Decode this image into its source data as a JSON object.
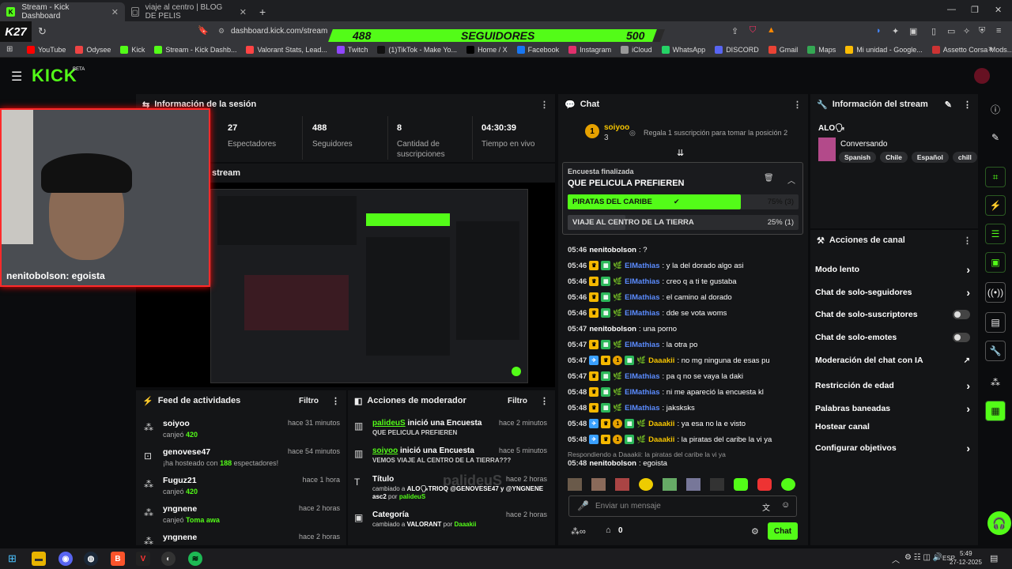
{
  "browser": {
    "tabs": [
      {
        "label": "Stream - Kick Dashboard",
        "active": true
      },
      {
        "label": "viaje al centro | BLOG DE PELIS",
        "active": false
      }
    ],
    "new_tab": "+",
    "url": "dashboard.kick.com/stream",
    "brand_overlay": "K27",
    "follower_goal": {
      "current": "488",
      "label": "SEGUIDORES",
      "target": "500",
      "progress": 0.976
    },
    "bookmarks": [
      "YouTube",
      "Odysee",
      "Kick",
      "Stream - Kick Dashb...",
      "Valorant Stats, Lead...",
      "Twitch",
      "(1)TikTok - Make Yo...",
      "Home / X",
      "Facebook",
      "Instagram",
      "iCloud",
      "WhatsApp",
      "DISCORD",
      "Gmail",
      "Maps",
      "Mi unidad - Google...",
      "Assetto Corsa Mods..."
    ]
  },
  "site": {
    "logo": "KICK",
    "logo_sup": "BETA"
  },
  "session": {
    "title": "Información de la sesión",
    "stats": [
      {
        "value": "27",
        "label": "Espectadores"
      },
      {
        "value": "488",
        "label": "Seguidores"
      },
      {
        "value": "8",
        "label": "Cantidad de suscripciones"
      },
      {
        "value": "04:30:39",
        "label": "Tiempo en vivo"
      }
    ]
  },
  "stream_panel": {
    "title": "stream"
  },
  "webcam_caption": "nenitobolson: egoista",
  "feed": {
    "title": "Feed de actividades",
    "filter": "Filtro",
    "items": [
      {
        "name": "soiyoo",
        "sub_prefix": "canjeó ",
        "sub_bold": "420",
        "sub_suffix": "",
        "time": "hace 31 minutos",
        "icon": "kick-icon"
      },
      {
        "name": "genovese47",
        "sub_prefix": "¡ha hosteado con ",
        "sub_bold": "188",
        "sub_suffix": " espectadores!",
        "time": "hace 54 minutos",
        "icon": "host-icon"
      },
      {
        "name": "Fuguz21",
        "sub_prefix": "canjeó ",
        "sub_bold": "420",
        "sub_suffix": "",
        "time": "hace 1 hora",
        "icon": "kick-icon"
      },
      {
        "name": "yngnene",
        "sub_prefix": "canjeó ",
        "sub_bold": "Toma awa",
        "sub_suffix": "",
        "time": "hace 2 horas",
        "icon": "kick-icon"
      },
      {
        "name": "yngnene",
        "sub_prefix": "",
        "sub_bold": "",
        "sub_suffix": "",
        "time": "hace 2 horas",
        "icon": "kick-icon"
      }
    ]
  },
  "mod": {
    "title": "Acciones de moderador",
    "filter": "Filtro",
    "watermark": "palideuS",
    "items": [
      {
        "user": "palideuS",
        "action": " inició una Encuesta",
        "detail": "QUE PELICULA PREFIEREN",
        "time": "hace 2 minutos"
      },
      {
        "user": "soiyoo",
        "action": " inició una Encuesta",
        "detail": "VEMOS VIAJE AL CENTRO DE LA TIERRA???",
        "time": "hace 5 minutos"
      },
      {
        "user": "",
        "action": "Título",
        "detail_prefix": "cambiado a ",
        "detail": "ALO🗣TRIOQ @GENOVESE47 y @YNGNENE asc2",
        "detail_suffix": " por ",
        "detail_user": "palideuS",
        "time": "hace 2 horas"
      },
      {
        "user": "",
        "action": "Categoría",
        "detail_prefix": "cambiado a ",
        "detail": "VALORANT",
        "detail_suffix": " por ",
        "detail_user": "Daaakii",
        "time": "hace 2 horas"
      }
    ]
  },
  "chat": {
    "title": "Chat",
    "gift_leader": {
      "name": "soiyoo",
      "count": "3",
      "rank": "1",
      "tip": "Regala 1 suscripción para tomar la posición 2"
    },
    "poll": {
      "status": "Encuesta finalizada",
      "question": "QUE PELICULA PREFIEREN",
      "options": [
        {
          "label": "PIRATAS DEL CARIBE",
          "result": "75% (3)",
          "share": 0.75,
          "winner": true
        },
        {
          "label": "VIAJE AL CENTRO DE LA TIERRA",
          "result": "25% (1)",
          "share": 0.25,
          "winner": false
        }
      ]
    },
    "messages": [
      {
        "time": "05:46",
        "user": "nenitobolson",
        "text": ": ?",
        "badges": "",
        "color": "white"
      },
      {
        "time": "05:46",
        "user": "ElMathias",
        "text": ": y la del dorado algo asi",
        "badges": "cs",
        "color": "blue"
      },
      {
        "time": "05:46",
        "user": "ElMathias",
        "text": ": creo q a ti te gustaba",
        "badges": "cs",
        "color": "blue"
      },
      {
        "time": "05:46",
        "user": "ElMathias",
        "text": ": el camino al dorado",
        "badges": "cs",
        "color": "blue"
      },
      {
        "time": "05:46",
        "user": "ElMathias",
        "text": ": dde se vota woms",
        "badges": "cs",
        "color": "blue"
      },
      {
        "time": "05:47",
        "user": "nenitobolson",
        "text": ": una porno",
        "badges": "",
        "color": "white"
      },
      {
        "time": "05:47",
        "user": "ElMathias",
        "text": ": la otra po",
        "badges": "cs",
        "color": "blue"
      },
      {
        "time": "05:47",
        "user": "Daaakii",
        "text": ": no mg ninguna de esas pu",
        "badges": "bcsg",
        "color": "gold"
      },
      {
        "time": "05:47",
        "user": "ElMathias",
        "text": ": pa q no se vaya la daki",
        "badges": "cs",
        "color": "blue"
      },
      {
        "time": "05:48",
        "user": "ElMathias",
        "text": ": ni me apareció la encuesta kl",
        "badges": "cs",
        "color": "blue"
      },
      {
        "time": "05:48",
        "user": "ElMathias",
        "text": ": jaksksks",
        "badges": "cs",
        "color": "blue"
      },
      {
        "time": "05:48",
        "user": "Daaakii",
        "text": ": ya esa no la e visto",
        "badges": "bcsg",
        "color": "gold"
      },
      {
        "time": "05:48",
        "user": "Daaakii",
        "text": ": la piratas del caribe la vi ya",
        "badges": "bcsg",
        "color": "gold"
      }
    ],
    "reply_hint": "Respondiendo a Daaakii: la piratas del caribe la vi ya",
    "last": {
      "time": "05:48",
      "user": "nenitobolson",
      "text": ": egoista"
    },
    "input_placeholder": "Enviar un mensaje",
    "points": "0",
    "send_label": "Chat"
  },
  "stream_info": {
    "title": "Información del stream",
    "stream_title": "ALO🗣",
    "category": "Conversando",
    "tags": [
      "Spanish",
      "Chile",
      "Español",
      "chill"
    ]
  },
  "channel_actions": {
    "title": "Acciones de canal",
    "items": [
      {
        "label": "Modo lento",
        "kind": "chevron"
      },
      {
        "label": "Chat de solo-seguidores",
        "kind": "chevron"
      },
      {
        "label": "Chat de solo-suscriptores",
        "kind": "toggle"
      },
      {
        "label": "Chat de solo-emotes",
        "kind": "toggle"
      },
      {
        "label": "Moderación del chat con IA",
        "kind": "external"
      },
      {
        "label": "Restricción de edad",
        "kind": "chevron"
      },
      {
        "label": "Palabras baneadas",
        "kind": "chevron"
      },
      {
        "label": "Hostear canal",
        "kind": "none"
      },
      {
        "label": "Configurar objetivos",
        "kind": "chevron"
      }
    ]
  },
  "taskbar": {
    "lang": "ESP",
    "time": "5:49",
    "date": "27-12-2025"
  },
  "colors": {
    "accent": "#53fc18",
    "panel": "#141517",
    "bg": "#0b0c0e"
  }
}
